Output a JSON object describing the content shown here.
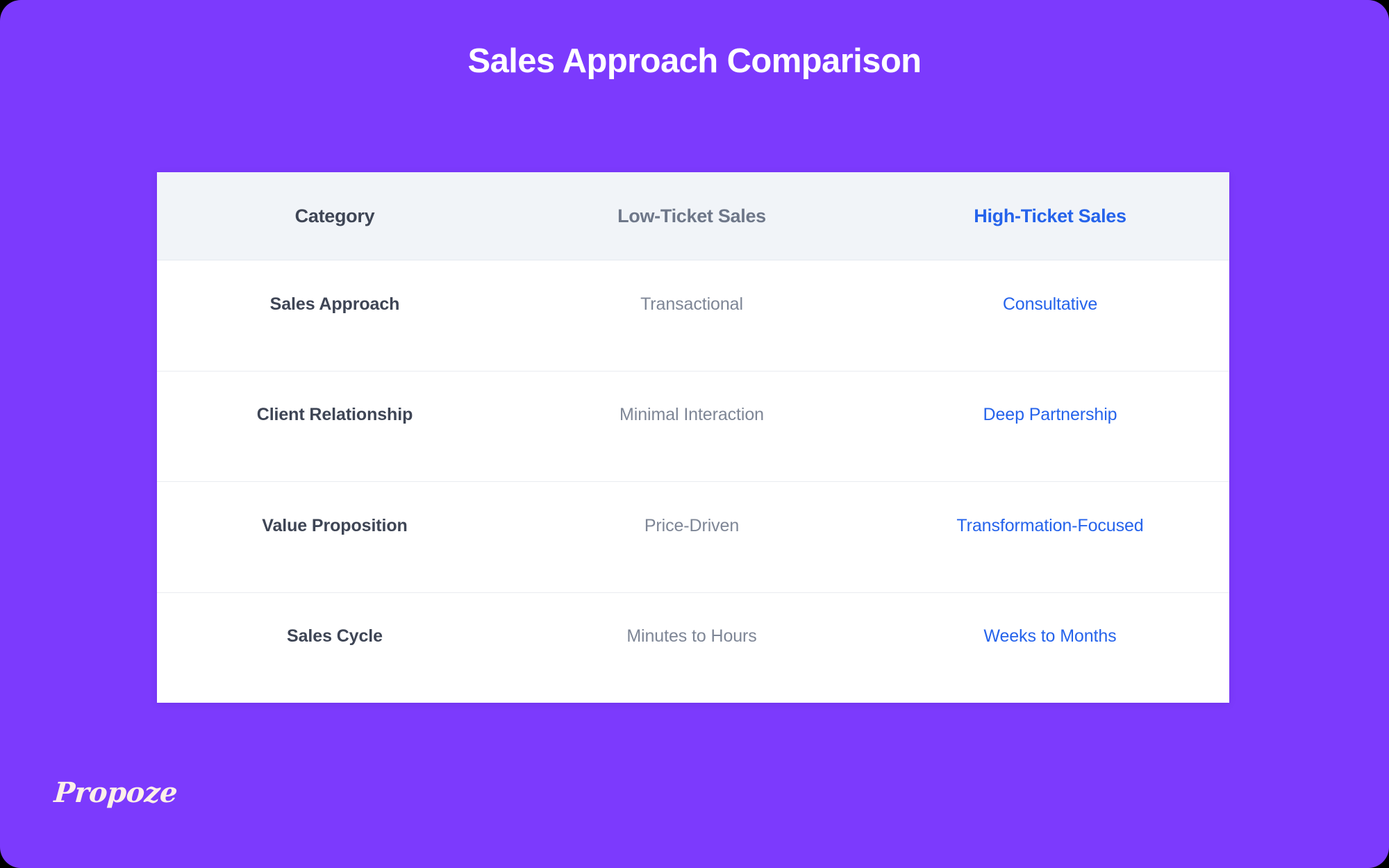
{
  "page": {
    "title": "Sales Approach Comparison",
    "background_color": "#7C3AFD"
  },
  "brand": {
    "logo_text": "Propoze",
    "logo_color": "#FCEFE9"
  },
  "colors": {
    "purple_background": "#7C3AFD",
    "accent_blue": "#2563EB",
    "header_background": "#F1F4F8",
    "dark_slate_text": "#3E4555",
    "muted_text": "#6E7789",
    "body_muted_text": "#7E8696",
    "row_divider": "#EAECF0"
  },
  "table": {
    "headers": [
      {
        "label": "Category",
        "color": "#3E4555"
      },
      {
        "label": "Low-Ticket Sales",
        "color": "#6E7789"
      },
      {
        "label": "High-Ticket Sales",
        "color": "#2563EB"
      }
    ],
    "rows": [
      {
        "category": "Sales Approach",
        "low_ticket": "Transactional",
        "high_ticket": "Consultative"
      },
      {
        "category": "Client Relationship",
        "low_ticket": "Minimal Interaction",
        "high_ticket": "Deep Partnership"
      },
      {
        "category": "Value Proposition",
        "low_ticket": "Price-Driven",
        "high_ticket": "Transformation-Focused"
      },
      {
        "category": "Sales Cycle",
        "low_ticket": "Minutes to Hours",
        "high_ticket": "Weeks to Months"
      }
    ]
  }
}
